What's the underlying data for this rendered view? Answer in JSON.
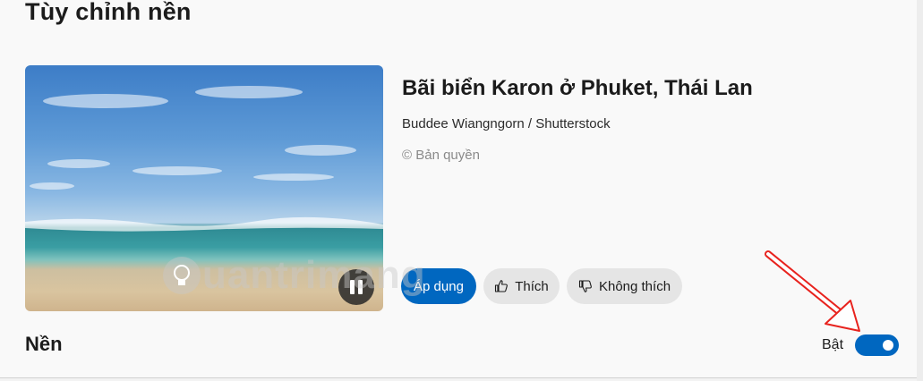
{
  "page": {
    "title": "Tùy chỉnh nền"
  },
  "spotlight": {
    "image_title": "Bãi biển Karon ở Phuket, Thái Lan",
    "author": "Buddee Wiangngorn / Shutterstock",
    "copyright": "© Bản quyền",
    "buttons": {
      "apply": "Áp dụng",
      "like": "Thích",
      "dislike": "Không thích"
    }
  },
  "background_section": {
    "title": "Nền",
    "toggle_label": "Bật",
    "toggle_on": true
  },
  "watermark": {
    "text": "uantrimang"
  },
  "colors": {
    "accent": "#0067c0",
    "annotation_arrow": "#e8231e"
  }
}
